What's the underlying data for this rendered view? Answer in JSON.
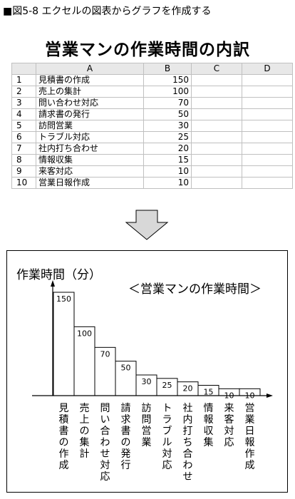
{
  "figure_caption": "■図5-8 エクセルの図表からグラフを作成する",
  "table_title": "営業マンの作業時間の内訳",
  "sheet": {
    "columns": [
      "A",
      "B",
      "C",
      "D"
    ],
    "rows": [
      {
        "num": "1",
        "a": "見積書の作成",
        "b": "150"
      },
      {
        "num": "2",
        "a": "売上の集計",
        "b": "100"
      },
      {
        "num": "3",
        "a": "問い合わせ対応",
        "b": "70"
      },
      {
        "num": "4",
        "a": "請求書の発行",
        "b": "50"
      },
      {
        "num": "5",
        "a": "訪問営業",
        "b": "30"
      },
      {
        "num": "6",
        "a": "トラブル対応",
        "b": "25"
      },
      {
        "num": "7",
        "a": "社内打ち合わせ",
        "b": "20"
      },
      {
        "num": "8",
        "a": "情報収集",
        "b": "15"
      },
      {
        "num": "9",
        "a": "来客対応",
        "b": "10"
      },
      {
        "num": "10",
        "a": "営業日報作成",
        "b": "10"
      }
    ]
  },
  "chart_data": {
    "type": "bar",
    "title": "＜営業マンの作業時間＞",
    "ylabel": "作業時間（分）",
    "xlabel": "",
    "categories": [
      "見積書の作成",
      "売上の集計",
      "問い合わせ対応",
      "請求書の発行",
      "訪問営業",
      "トラブル対応",
      "社内打ち合わせ",
      "情報収集",
      "来客対応",
      "営業日報作成"
    ],
    "values": [
      150,
      100,
      70,
      50,
      30,
      25,
      20,
      15,
      10,
      10
    ],
    "ylim": [
      0,
      150
    ],
    "grid": false
  },
  "colors": {
    "bar_fill": "#ffffff",
    "bar_stroke": "#000000"
  },
  "icons": {
    "down_arrow": "down-arrow-icon"
  }
}
